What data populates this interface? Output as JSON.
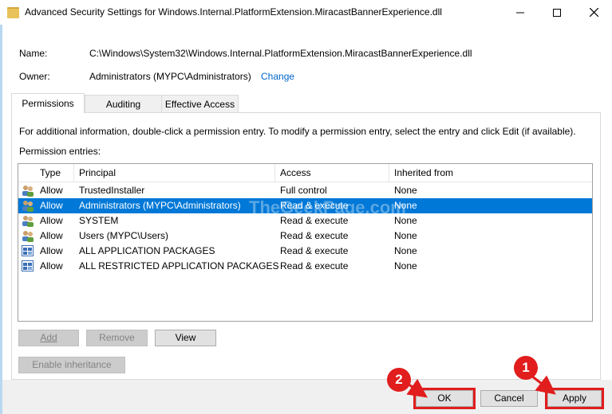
{
  "window": {
    "title": "Advanced Security Settings for Windows.Internal.PlatformExtension.MiracastBannerExperience.dll"
  },
  "info": {
    "name_label": "Name:",
    "name_value": "C:\\Windows\\System32\\Windows.Internal.PlatformExtension.MiracastBannerExperience.dll",
    "owner_label": "Owner:",
    "owner_value": "Administrators (MYPC\\Administrators)",
    "change_link": "Change"
  },
  "tabs": [
    {
      "label": "Permissions",
      "active": true
    },
    {
      "label": "Auditing",
      "active": false
    },
    {
      "label": "Effective Access",
      "active": false
    }
  ],
  "permissions": {
    "info_text": "For additional information, double-click a permission entry. To modify a permission entry, select the entry and click Edit (if available).",
    "entries_label": "Permission entries:",
    "columns": [
      "Type",
      "Principal",
      "Access",
      "Inherited from"
    ],
    "rows": [
      {
        "type": "Allow",
        "principal": "TrustedInstaller",
        "access": "Full control",
        "inherited": "None",
        "icon": "users-icon"
      },
      {
        "type": "Allow",
        "principal": "Administrators (MYPC\\Administrators)",
        "access": "Read & execute",
        "inherited": "None",
        "icon": "users-icon",
        "selected": true
      },
      {
        "type": "Allow",
        "principal": "SYSTEM",
        "access": "Read & execute",
        "inherited": "None",
        "icon": "users-icon"
      },
      {
        "type": "Allow",
        "principal": "Users (MYPC\\Users)",
        "access": "Read & execute",
        "inherited": "None",
        "icon": "users-icon"
      },
      {
        "type": "Allow",
        "principal": "ALL APPLICATION PACKAGES",
        "access": "Read & execute",
        "inherited": "None",
        "icon": "app-package-icon"
      },
      {
        "type": "Allow",
        "principal": "ALL RESTRICTED APPLICATION PACKAGES",
        "access": "Read & execute",
        "inherited": "None",
        "icon": "app-package-icon"
      }
    ]
  },
  "buttons": {
    "add": "Add",
    "remove": "Remove",
    "view": "View",
    "enable_inheritance": "Enable inheritance",
    "ok": "OK",
    "cancel": "Cancel",
    "apply": "Apply"
  },
  "annotations": {
    "badge_ok": "2",
    "badge_apply": "1",
    "color": "#e11d1d"
  },
  "watermark": "TheGeekPage.com"
}
